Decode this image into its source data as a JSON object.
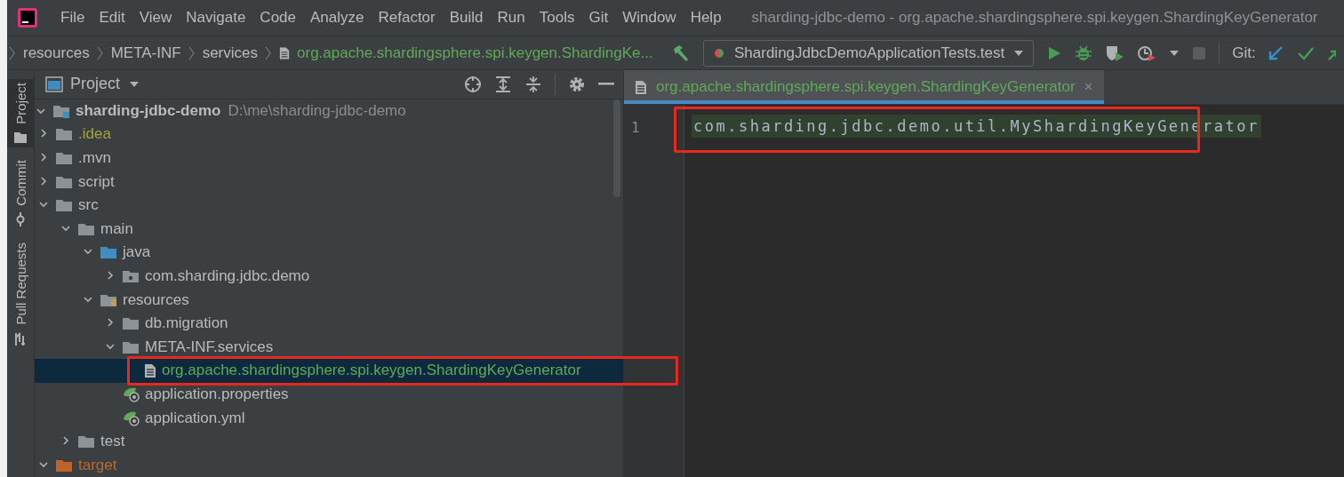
{
  "menu": [
    "File",
    "Edit",
    "View",
    "Navigate",
    "Code",
    "Analyze",
    "Refactor",
    "Build",
    "Run",
    "Tools",
    "Git",
    "Window",
    "Help"
  ],
  "window": {
    "title": "sharding-jdbc-demo - org.apache.shardingsphere.spi.keygen.ShardingKeyGenerator"
  },
  "breadcrumbs": [
    {
      "label": "resources",
      "kind": "folder"
    },
    {
      "label": "META-INF",
      "kind": "folder"
    },
    {
      "label": "services",
      "kind": "folder"
    },
    {
      "label": "org.apache.shardingsphere.spi.keygen.ShardingKe...",
      "kind": "file"
    }
  ],
  "run_config": {
    "label": "ShardingJdbcDemoApplicationTests.test"
  },
  "git_label": "Git:",
  "side_tabs": [
    {
      "label": "Project",
      "selected": true,
      "kind": "project"
    },
    {
      "label": "Commit",
      "selected": false,
      "kind": "commit"
    },
    {
      "label": "Pull Requests",
      "selected": false,
      "kind": "pull"
    }
  ],
  "project_panel": {
    "title": "Project",
    "root": {
      "name": "sharding-jdbc-demo",
      "path": "D:\\me\\sharding-jdbc-demo",
      "expanded": true
    },
    "tree": [
      {
        "label": ".idea",
        "kind": "folder",
        "expanded": false,
        "color": "#a4a43d",
        "selected": false,
        "highlighted": false
      },
      {
        "label": ".mvn",
        "kind": "folder",
        "expanded": false,
        "color": "#bbbbbb",
        "selected": false,
        "highlighted": false
      },
      {
        "label": "script",
        "kind": "folder",
        "expanded": false,
        "color": "#bbbbbb",
        "selected": false,
        "highlighted": false
      },
      {
        "label": "src",
        "kind": "folder",
        "expanded": true,
        "color": "#bbbbbb",
        "selected": false,
        "highlighted": false,
        "children": [
          {
            "label": "main",
            "kind": "folder",
            "expanded": true,
            "color": "#bbbbbb",
            "selected": false,
            "highlighted": false,
            "children": [
              {
                "label": "java",
                "kind": "source",
                "expanded": true,
                "color": "#bbbbbb",
                "selected": false,
                "highlighted": false,
                "children": [
                  {
                    "label": "com.sharding.jdbc.demo",
                    "kind": "package",
                    "expanded": false,
                    "color": "#bbbbbb",
                    "selected": false,
                    "highlighted": false
                  }
                ]
              },
              {
                "label": "resources",
                "kind": "resources",
                "expanded": true,
                "color": "#bbbbbb",
                "selected": false,
                "highlighted": false,
                "children": [
                  {
                    "label": "db.migration",
                    "kind": "folder",
                    "expanded": false,
                    "color": "#bbbbbb",
                    "selected": false,
                    "highlighted": false
                  },
                  {
                    "label": "META-INF.services",
                    "kind": "folder",
                    "expanded": true,
                    "color": "#bbbbbb",
                    "selected": false,
                    "highlighted": false,
                    "children": [
                      {
                        "label": "org.apache.shardingsphere.spi.keygen.ShardingKeyGenerator",
                        "kind": "file",
                        "color": "#62a85a",
                        "selected": true,
                        "highlighted": true
                      }
                    ]
                  },
                  {
                    "label": "application.properties",
                    "kind": "spring",
                    "color": "#bbbbbb",
                    "selected": false,
                    "highlighted": false
                  },
                  {
                    "label": "application.yml",
                    "kind": "spring",
                    "color": "#bbbbbb",
                    "selected": false,
                    "highlighted": false
                  }
                ]
              }
            ]
          },
          {
            "label": "test",
            "kind": "folder",
            "expanded": false,
            "color": "#bbbbbb",
            "selected": false,
            "highlighted": false
          }
        ]
      },
      {
        "label": "target",
        "kind": "excluded",
        "expanded": true,
        "color": "#b8692e",
        "selected": false,
        "highlighted": false
      }
    ]
  },
  "editor": {
    "tab": {
      "label": "org.apache.shardingsphere.spi.keygen.ShardingKeyGenerator",
      "close": "×",
      "selected": true
    },
    "lines": [
      {
        "number": "1",
        "text": "com.sharding.jdbc.demo.util.MyShardingKeyGenerator",
        "highlighted": true
      }
    ]
  }
}
